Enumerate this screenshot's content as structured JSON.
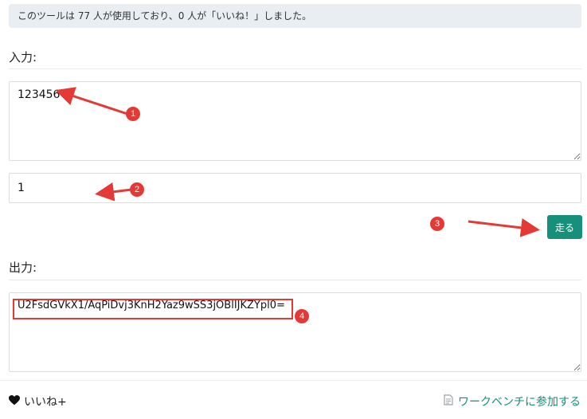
{
  "notice": {
    "text": "このツールは 77 人が使用しており、0 人が「いいね！」しました。"
  },
  "input_section": {
    "title": "入力:",
    "text_value": "123456",
    "key_value": "1"
  },
  "run_button": {
    "label": "走る"
  },
  "output_section": {
    "title": "出力:",
    "text_value": "U2FsdGVkX1/AqPiDvj3KnH2Yaz9wSS3jOBlIJKZYpl0="
  },
  "footer": {
    "like_label": "いいね+",
    "workbench_label": "ワークベンチに参加する"
  },
  "annotations": {
    "badge_1": "1",
    "badge_2": "2",
    "badge_3": "3",
    "badge_4": "4"
  },
  "colors": {
    "accent": "#16907a",
    "annotation": "#e53935"
  }
}
